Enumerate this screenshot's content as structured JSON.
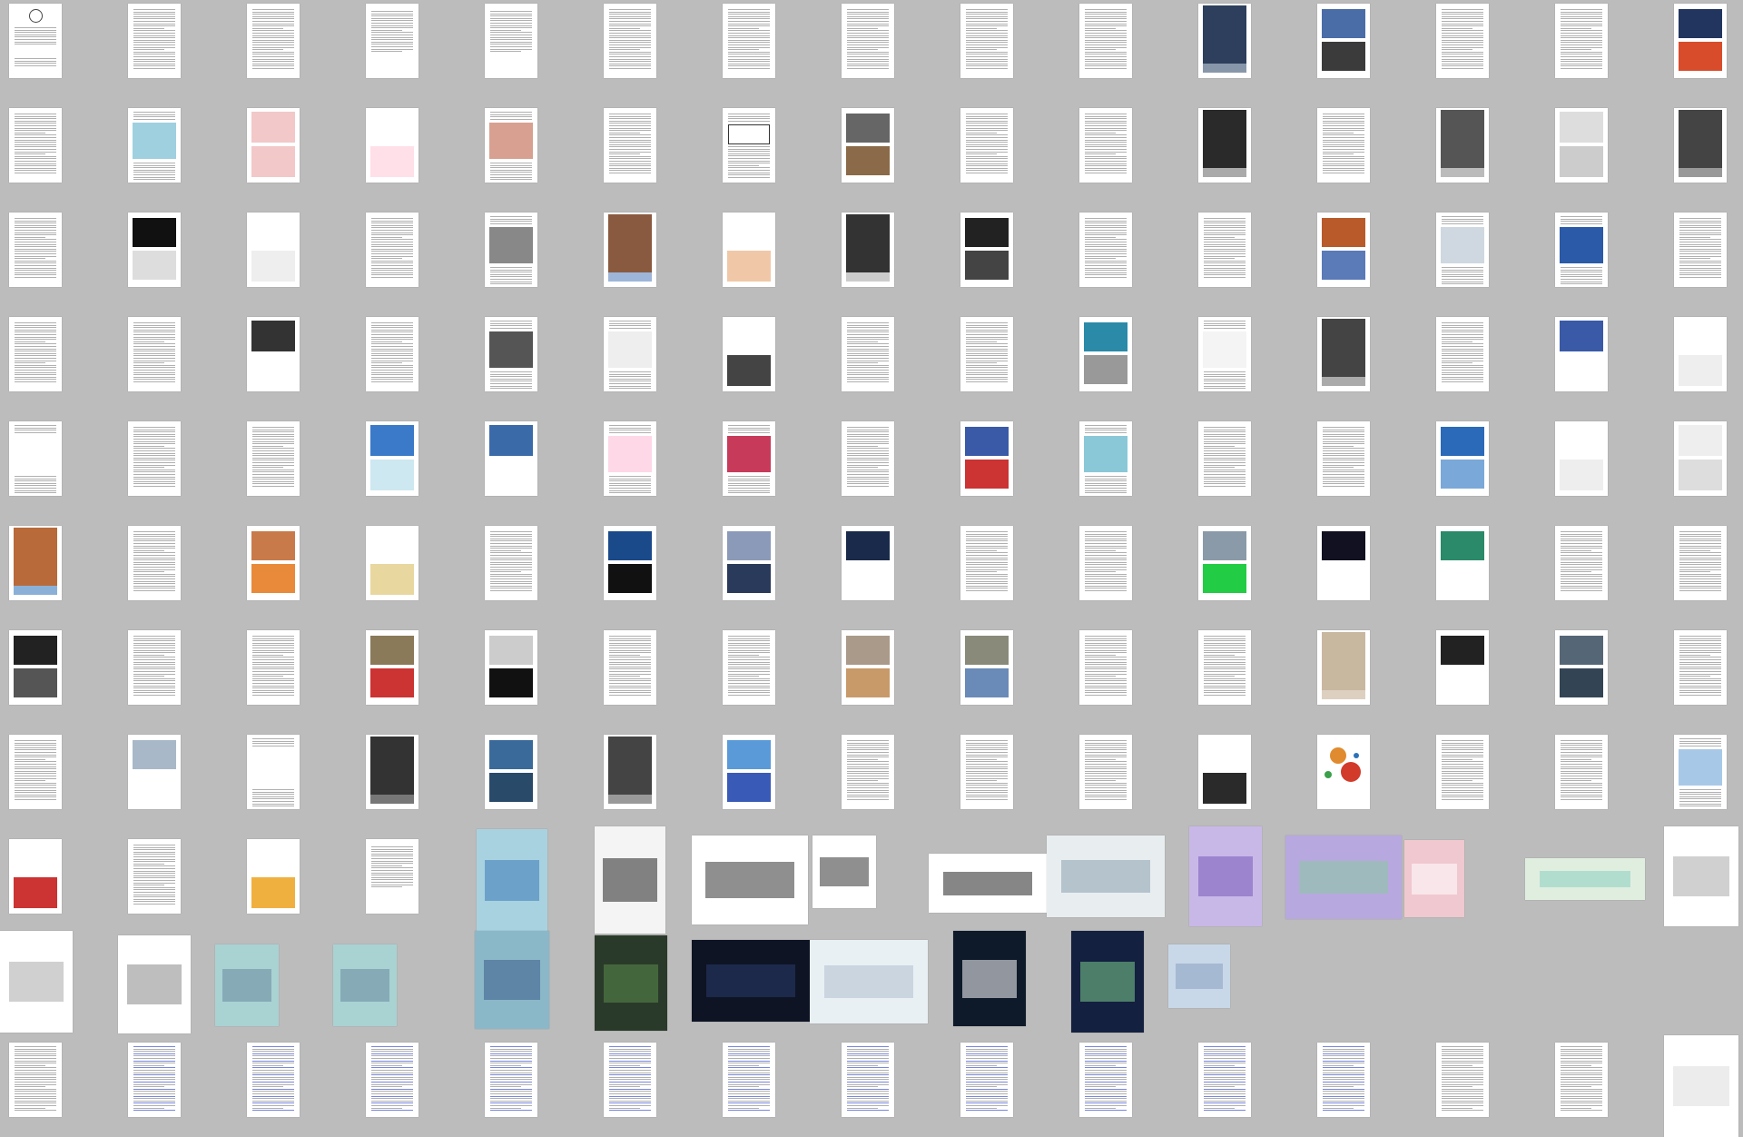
{
  "viewer": {
    "background": "#bcbcbc",
    "page_count": 147
  },
  "palette": {
    "doc": "#ffffff",
    "text": "#6f6f6f",
    "link": "#4a5fd8",
    "sky": "#7fb2dd",
    "night": "#101626",
    "photo_dark": "#3b3d42",
    "teal_board": "#a9d2d3",
    "aurora": "#b3a6dd",
    "orange": "#e08b2f",
    "red": "#d23a2a",
    "blueprint": "#2c72b8"
  },
  "pages": [
    {
      "k": "title"
    },
    {
      "k": "text"
    },
    {
      "k": "text"
    },
    {
      "k": "toc"
    },
    {
      "k": "toc"
    },
    {
      "k": "text"
    },
    {
      "k": "text"
    },
    {
      "k": "text"
    },
    {
      "k": "text"
    },
    {
      "k": "text"
    },
    {
      "k": "photo",
      "c": [
        "#2d3f5c",
        "#8896aa"
      ]
    },
    {
      "k": "photo2",
      "c": [
        "#4a6da8",
        "#3b3b3b"
      ]
    },
    {
      "k": "text"
    },
    {
      "k": "text"
    },
    {
      "k": "photo2",
      "c": [
        "#22355f",
        "#d84c2b"
      ]
    },
    {
      "k": "text"
    },
    {
      "k": "img1",
      "c": [
        "#9fd0e0"
      ]
    },
    {
      "k": "img2",
      "c": [
        "#f2c8c8",
        "#f2c8c8"
      ]
    },
    {
      "k": "img2",
      "c": [
        "#ffffff",
        "#ffe0e8"
      ]
    },
    {
      "k": "img1",
      "c": [
        "#d8a090"
      ]
    },
    {
      "k": "text"
    },
    {
      "k": "diagram"
    },
    {
      "k": "photo2",
      "c": [
        "#666666",
        "#8a6a48"
      ]
    },
    {
      "k": "text"
    },
    {
      "k": "text"
    },
    {
      "k": "photo",
      "c": [
        "#2a2a2a",
        "#aaaaaa"
      ]
    },
    {
      "k": "text"
    },
    {
      "k": "photo",
      "c": [
        "#555555",
        "#bbbbbb"
      ]
    },
    {
      "k": "img2",
      "c": [
        "#dddddd",
        "#cccccc"
      ]
    },
    {
      "k": "photo",
      "c": [
        "#444444",
        "#999999"
      ]
    },
    {
      "k": "text"
    },
    {
      "k": "photo2",
      "c": [
        "#111111",
        "#dddddd"
      ]
    },
    {
      "k": "img2",
      "c": [
        "#ffffff",
        "#eeeeee"
      ]
    },
    {
      "k": "text"
    },
    {
      "k": "img1",
      "c": [
        "#888888"
      ]
    },
    {
      "k": "photo",
      "c": [
        "#8a5a40",
        "#9db5d8"
      ]
    },
    {
      "k": "img2",
      "c": [
        "#ffffff",
        "#f0c8a8"
      ]
    },
    {
      "k": "photo",
      "c": [
        "#333333",
        "#cccccc"
      ]
    },
    {
      "k": "photo2",
      "c": [
        "#222222",
        "#444444"
      ]
    },
    {
      "k": "text"
    },
    {
      "k": "text"
    },
    {
      "k": "photo2",
      "c": [
        "#b85a2a",
        "#5a7ab8"
      ]
    },
    {
      "k": "img1",
      "c": [
        "#cfd8e0"
      ]
    },
    {
      "k": "img1",
      "c": [
        "#2a5aa8"
      ]
    },
    {
      "k": "text"
    },
    {
      "k": "text"
    },
    {
      "k": "text"
    },
    {
      "k": "img2",
      "c": [
        "#333333",
        "#ffffff"
      ]
    },
    {
      "k": "text"
    },
    {
      "k": "img1",
      "c": [
        "#555555"
      ]
    },
    {
      "k": "img1",
      "c": [
        "#eeeeee"
      ]
    },
    {
      "k": "img2",
      "c": [
        "#ffffff",
        "#444444"
      ]
    },
    {
      "k": "text"
    },
    {
      "k": "text"
    },
    {
      "k": "photo2",
      "c": [
        "#2a8aa8",
        "#999999"
      ]
    },
    {
      "k": "img1",
      "c": [
        "#f4f4f4"
      ]
    },
    {
      "k": "photo",
      "c": [
        "#444444",
        "#aaaaaa"
      ]
    },
    {
      "k": "text"
    },
    {
      "k": "img2",
      "c": [
        "#3a5aa8",
        "#ffffff"
      ]
    },
    {
      "k": "img2",
      "c": [
        "#ffffff",
        "#eeeeee"
      ]
    },
    {
      "k": "img1",
      "c": [
        "#ffffff"
      ]
    },
    {
      "k": "text"
    },
    {
      "k": "text"
    },
    {
      "k": "img2",
      "c": [
        "#3a7ac8",
        "#cde8f0"
      ]
    },
    {
      "k": "img2",
      "c": [
        "#3a6aa8",
        "#ffffff"
      ]
    },
    {
      "k": "img1",
      "c": [
        "#ffd8e8"
      ]
    },
    {
      "k": "img1",
      "c": [
        "#c83a5a"
      ]
    },
    {
      "k": "text"
    },
    {
      "k": "photo2",
      "c": [
        "#3a5aa8",
        "#cc3333"
      ]
    },
    {
      "k": "img1",
      "c": [
        "#8ac8d8"
      ]
    },
    {
      "k": "text"
    },
    {
      "k": "text"
    },
    {
      "k": "photo2",
      "c": [
        "#2a6ab8",
        "#7aa8d8"
      ]
    },
    {
      "k": "img2",
      "c": [
        "#ffffff",
        "#eeeeee"
      ]
    },
    {
      "k": "img2",
      "c": [
        "#eeeeee",
        "#dddddd"
      ]
    },
    {
      "k": "photo",
      "c": [
        "#b86a3a",
        "#8ab0d8"
      ]
    },
    {
      "k": "text"
    },
    {
      "k": "photo2",
      "c": [
        "#c87a4a",
        "#e88a3a"
      ]
    },
    {
      "k": "img2",
      "c": [
        "#ffffff",
        "#e8d8a0"
      ]
    },
    {
      "k": "text"
    },
    {
      "k": "photo2",
      "c": [
        "#1a4a8a",
        "#111111"
      ]
    },
    {
      "k": "photo2",
      "c": [
        "#8a9ab8",
        "#2a3a5a"
      ]
    },
    {
      "k": "photo2",
      "c": [
        "#1a2a4a",
        "#ffffff"
      ]
    },
    {
      "k": "text"
    },
    {
      "k": "text"
    },
    {
      "k": "photo2",
      "c": [
        "#8a9aa8",
        "#22cc44"
      ]
    },
    {
      "k": "photo2",
      "c": [
        "#111122",
        "#ffffff"
      ]
    },
    {
      "k": "photo2",
      "c": [
        "#2a8a6a",
        "#ffffff"
      ]
    },
    {
      "k": "text"
    },
    {
      "k": "text"
    },
    {
      "k": "photo2",
      "c": [
        "#222222",
        "#555555"
      ]
    },
    {
      "k": "text"
    },
    {
      "k": "text"
    },
    {
      "k": "photo2",
      "c": [
        "#8a7a5a",
        "#cc3333"
      ]
    },
    {
      "k": "photo2",
      "c": [
        "#cccccc",
        "#111111"
      ]
    },
    {
      "k": "text"
    },
    {
      "k": "text"
    },
    {
      "k": "photo2",
      "c": [
        "#aa9a8a",
        "#c89a6a"
      ]
    },
    {
      "k": "photo2",
      "c": [
        "#8a8a7a",
        "#6a8ab8"
      ]
    },
    {
      "k": "text"
    },
    {
      "k": "text"
    },
    {
      "k": "photo",
      "c": [
        "#c8b8a0",
        "#ddd0c0"
      ]
    },
    {
      "k": "photo2",
      "c": [
        "#222222",
        "#ffffff"
      ]
    },
    {
      "k": "photo2",
      "c": [
        "#556677",
        "#334455"
      ]
    },
    {
      "k": "text"
    },
    {
      "k": "text"
    },
    {
      "k": "photo2",
      "c": [
        "#a8b8c8",
        "#ffffff"
      ]
    },
    {
      "k": "img1",
      "c": [
        "#ffffff"
      ]
    },
    {
      "k": "photo",
      "c": [
        "#333333",
        "#777777"
      ]
    },
    {
      "k": "photo2",
      "c": [
        "#3a6a9a",
        "#2a4a6a"
      ]
    },
    {
      "k": "photo",
      "c": [
        "#444444",
        "#999999"
      ]
    },
    {
      "k": "photo2",
      "c": [
        "#5a9ad8",
        "#3a5ab8"
      ]
    },
    {
      "k": "text"
    },
    {
      "k": "text"
    },
    {
      "k": "text"
    },
    {
      "k": "img2",
      "c": [
        "#ffffff",
        "#2a2a2a"
      ]
    },
    {
      "k": "circles"
    },
    {
      "k": "text"
    },
    {
      "k": "text"
    },
    {
      "k": "img1",
      "c": [
        "#a8c8e8"
      ]
    },
    {
      "k": "img2",
      "c": [
        "#ffffff",
        "#cc3333"
      ]
    },
    {
      "k": "text"
    },
    {
      "k": "img2",
      "c": [
        "#ffffff",
        "#f0b040"
      ]
    },
    {
      "k": "toc"
    }
  ],
  "wide": [
    {
      "k": "board",
      "c": [
        "#a9d2e0",
        "#3a7ab8"
      ]
    },
    {
      "k": "board",
      "c": [
        "#f4f4f4",
        "#222222"
      ]
    },
    {
      "k": "board",
      "c": [
        "#ffffff",
        "#333333"
      ]
    },
    {
      "k": "board",
      "c": [
        "#ffffff",
        "#333333"
      ]
    },
    {
      "k": "board",
      "c": [
        "#ffffff",
        "#222222"
      ]
    },
    {
      "k": "board",
      "c": [
        "#e8eef0",
        "#8aa0b0"
      ]
    },
    {
      "k": "board",
      "c": [
        "#c8b8e8",
        "#7a5ab8"
      ]
    },
    {
      "k": "board",
      "c": [
        "#b8a8e0",
        "#8ac8a0"
      ]
    },
    {
      "k": "board",
      "c": [
        "#f0c8d0",
        "#ffffff"
      ]
    },
    {
      "k": "board",
      "c": [
        "#e0eee0",
        "#8ad0c0"
      ]
    },
    {
      "k": "board",
      "c": [
        "#ffffff",
        "#aaaaaa"
      ]
    },
    {
      "k": "board",
      "c": [
        "#ffffff",
        "#aaaaaa"
      ]
    },
    {
      "k": "board",
      "c": [
        "#ffffff",
        "#888888"
      ]
    },
    {
      "k": "board",
      "c": [
        "#a9d2d3",
        "#6a8aa0"
      ]
    },
    {
      "k": "board",
      "c": [
        "#a9d2d3",
        "#6a8aa0"
      ]
    },
    {
      "k": "board",
      "c": [
        "#8ab8c8",
        "#3a5a8a"
      ]
    },
    {
      "k": "board",
      "c": [
        "#2a3a2a",
        "#5a8a4a"
      ]
    },
    {
      "k": "board",
      "c": [
        "#0e1424",
        "#2a3a6a"
      ]
    },
    {
      "k": "board",
      "c": [
        "#e8f0f4",
        "#b0c0d0"
      ]
    },
    {
      "k": "board",
      "c": [
        "#0e1a2a",
        "#ffffff"
      ]
    },
    {
      "k": "board",
      "c": [
        "#142040",
        "#7acc8a"
      ]
    },
    {
      "k": "board",
      "c": [
        "#c8d8e8",
        "#8aa0c0"
      ]
    },
    {
      "k": "board",
      "c": [
        "#ffffff",
        "#dddddd"
      ]
    }
  ]
}
